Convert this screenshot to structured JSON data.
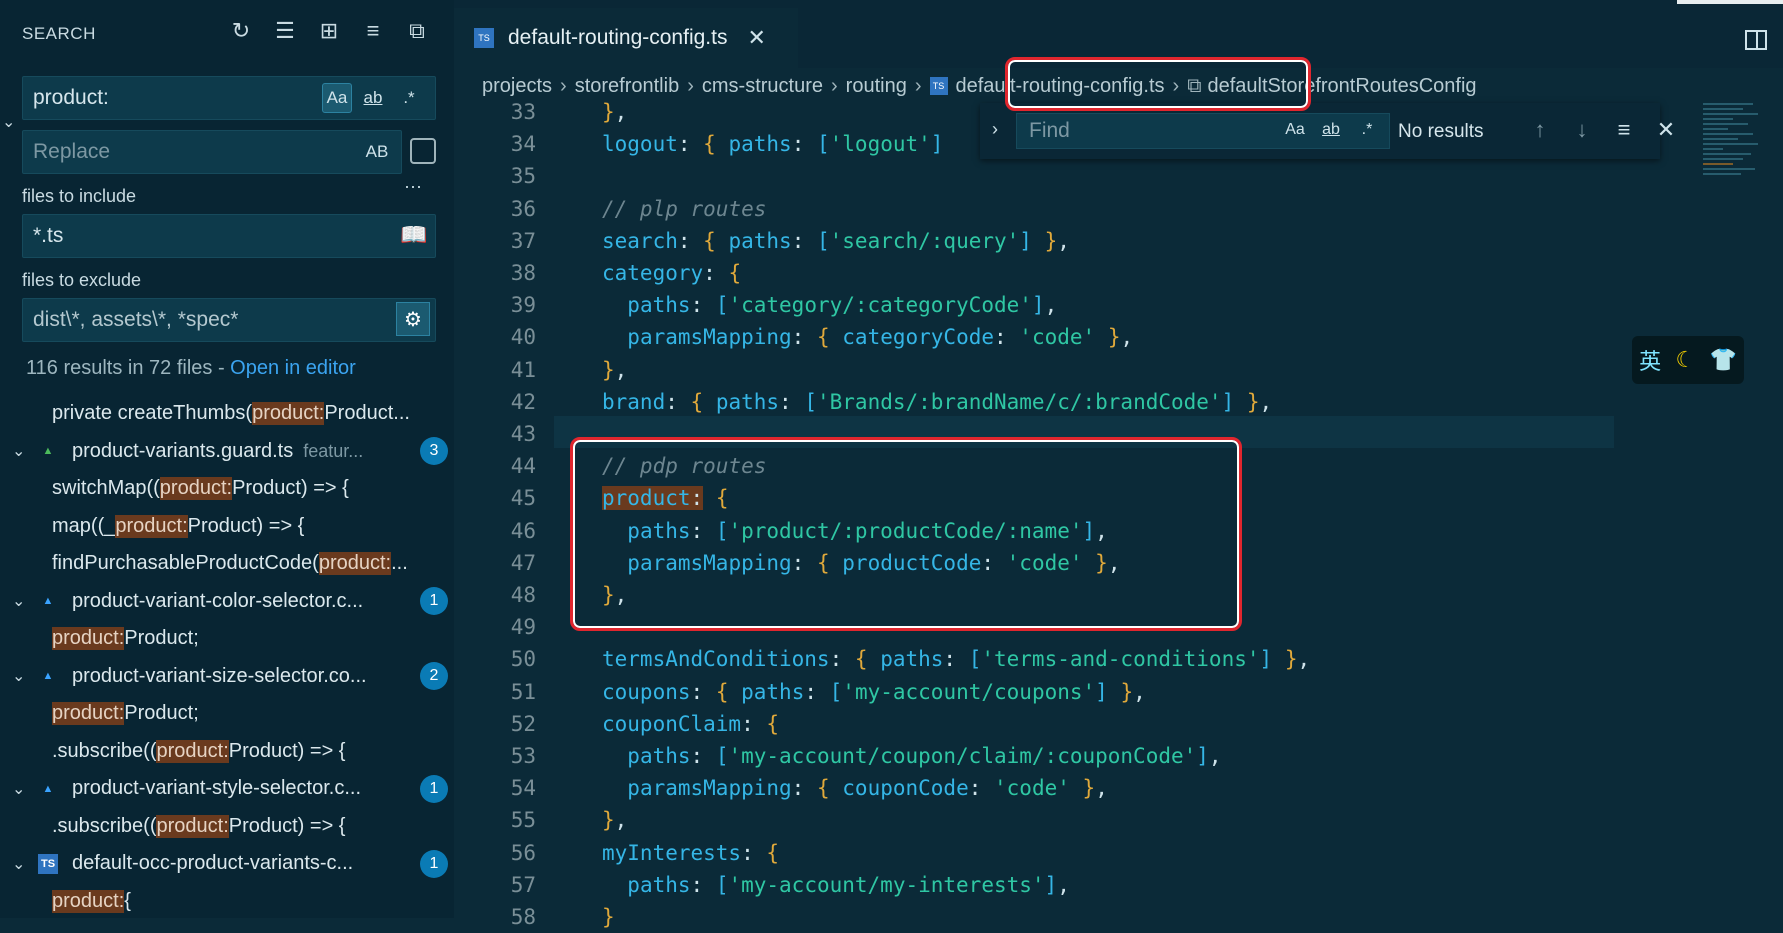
{
  "sidebar": {
    "title": "SEARCH",
    "search_value": "product:",
    "replace_placeholder": "Replace",
    "replace_opt": "AB",
    "include_label": "files to include",
    "include_value": "*.ts",
    "exclude_label": "files to exclude",
    "exclude_value": "dist\\*, assets\\*, *spec*",
    "more": "···",
    "opt_case": "Aa",
    "opt_word": "ab",
    "opt_regex": ".*",
    "summary": "116 results in 72 files - ",
    "open_in_editor": "Open in editor",
    "results": [
      {
        "type": "match",
        "pre": "private createThumbs(",
        "hl": "product:",
        "post": " Product..."
      },
      {
        "type": "file",
        "name": "product-variants.guard.ts",
        "path": "featur...",
        "count": "3",
        "icon": "angular-green"
      },
      {
        "type": "match",
        "pre": "switchMap((",
        "hl": "product:",
        "post": " Product) => {"
      },
      {
        "type": "match",
        "pre": "map((_",
        "hl": "product:",
        "post": " Product) => {"
      },
      {
        "type": "match",
        "pre": "findPurchasableProductCode(",
        "hl": "product:",
        "post": " ..."
      },
      {
        "type": "file",
        "name": "product-variant-color-selector.c...",
        "path": "",
        "count": "1",
        "icon": "angular"
      },
      {
        "type": "match",
        "pre": "",
        "hl": "product:",
        "post": " Product;"
      },
      {
        "type": "file",
        "name": "product-variant-size-selector.co...",
        "path": "",
        "count": "2",
        "icon": "angular"
      },
      {
        "type": "match",
        "pre": "",
        "hl": "product:",
        "post": " Product;"
      },
      {
        "type": "match",
        "pre": ".subscribe((",
        "hl": "product:",
        "post": " Product) => {"
      },
      {
        "type": "file",
        "name": "product-variant-style-selector.c...",
        "path": "",
        "count": "1",
        "icon": "angular"
      },
      {
        "type": "match",
        "pre": ".subscribe((",
        "hl": "product:",
        "post": " Product) => {"
      },
      {
        "type": "file",
        "name": "default-occ-product-variants-c...",
        "path": "",
        "count": "1",
        "icon": "ts"
      },
      {
        "type": "match",
        "pre": "",
        "hl": "product:",
        "post": " {"
      }
    ]
  },
  "editor": {
    "tab": "default-routing-config.ts",
    "ts_label": "TS",
    "breadcrumbs": [
      "projects",
      "storefrontlib",
      "cms-structure",
      "routing",
      "default-routing-config.ts",
      "defaultStorefrontRoutesConfig"
    ],
    "find": {
      "placeholder": "Find",
      "status": "No results",
      "case": "Aa",
      "word": "ab",
      "regex": ".*"
    },
    "lines": [
      {
        "n": "33",
        "html": "<span class='p'>}</span><span class='w'>,</span>"
      },
      {
        "n": "34",
        "html": "<span class='k'>logout</span><span class='w'>: </span><span class='p'>{</span><span class='w'> </span><span class='k'>paths</span><span class='w'>: </span><span class='k'>[</span><span class='s'>'logout'</span><span class='k'>]</span>"
      },
      {
        "n": "35",
        "html": ""
      },
      {
        "n": "36",
        "html": "<span class='c'>// plp routes</span>"
      },
      {
        "n": "37",
        "html": "<span class='k'>search</span><span class='w'>: </span><span class='p'>{</span><span class='w'> </span><span class='k'>paths</span><span class='w'>: </span><span class='k'>[</span><span class='s'>'search/:query'</span><span class='k'>]</span><span class='w'> </span><span class='p'>}</span><span class='w'>,</span>"
      },
      {
        "n": "38",
        "html": "<span class='k'>category</span><span class='w'>: </span><span class='p'>{</span>"
      },
      {
        "n": "39",
        "html": "  <span class='k'>paths</span><span class='w'>: </span><span class='k'>[</span><span class='s'>'category/:categoryCode'</span><span class='k'>]</span><span class='w'>,</span>"
      },
      {
        "n": "40",
        "html": "  <span class='k'>paramsMapping</span><span class='w'>: </span><span class='p'>{</span><span class='w'> </span><span class='k'>categoryCode</span><span class='w'>: </span><span class='s'>'code'</span><span class='w'> </span><span class='p'>}</span><span class='w'>,</span>"
      },
      {
        "n": "41",
        "html": "<span class='p'>}</span><span class='w'>,</span>"
      },
      {
        "n": "42",
        "html": "<span class='k'>brand</span><span class='w'>: </span><span class='p'>{</span><span class='w'> </span><span class='k'>paths</span><span class='w'>: </span><span class='k'>[</span><span class='s'>'Brands/:brandName/c/:brandCode'</span><span class='k'>]</span><span class='w'> </span><span class='p'>}</span><span class='w'>,</span>"
      },
      {
        "n": "43",
        "html": ""
      },
      {
        "n": "44",
        "html": "<span class='c'>// pdp routes</span>"
      },
      {
        "n": "45",
        "html": "<span class='k hl' style='background:#6a3a1e;'>product</span><span class='w hl' style='background:#6a3a1e;'>:</span><span class='w'> </span><span class='p'>{</span>"
      },
      {
        "n": "46",
        "html": "  <span class='k'>paths</span><span class='w'>: </span><span class='k'>[</span><span class='s'>'product/:productCode/:name'</span><span class='k'>]</span><span class='w'>,</span>"
      },
      {
        "n": "47",
        "html": "  <span class='k'>paramsMapping</span><span class='w'>: </span><span class='p'>{</span><span class='w'> </span><span class='k'>productCode</span><span class='w'>: </span><span class='s'>'code'</span><span class='w'> </span><span class='p'>}</span><span class='w'>,</span>"
      },
      {
        "n": "48",
        "html": "<span class='p'>}</span><span class='w'>,</span>"
      },
      {
        "n": "49",
        "html": ""
      },
      {
        "n": "50",
        "html": "<span class='k'>termsAndConditions</span><span class='w'>: </span><span class='p'>{</span><span class='w'> </span><span class='k'>paths</span><span class='w'>: </span><span class='k'>[</span><span class='s'>'terms-and-conditions'</span><span class='k'>]</span><span class='w'> </span><span class='p'>}</span><span class='w'>,</span>"
      },
      {
        "n": "51",
        "html": "<span class='k'>coupons</span><span class='w'>: </span><span class='p'>{</span><span class='w'> </span><span class='k'>paths</span><span class='w'>: </span><span class='k'>[</span><span class='s'>'my-account/coupons'</span><span class='k'>]</span><span class='w'> </span><span class='p'>}</span><span class='w'>,</span>"
      },
      {
        "n": "52",
        "html": "<span class='k'>couponClaim</span><span class='w'>: </span><span class='p'>{</span>"
      },
      {
        "n": "53",
        "html": "  <span class='k'>paths</span><span class='w'>: </span><span class='k'>[</span><span class='s'>'my-account/coupon/claim/:couponCode'</span><span class='k'>]</span><span class='w'>,</span>"
      },
      {
        "n": "54",
        "html": "  <span class='k'>paramsMapping</span><span class='w'>: </span><span class='p'>{</span><span class='w'> </span><span class='k'>couponCode</span><span class='w'>: </span><span class='s'>'code'</span><span class='w'> </span><span class='p'>}</span><span class='w'>,</span>"
      },
      {
        "n": "55",
        "html": "<span class='p'>}</span><span class='w'>,</span>"
      },
      {
        "n": "56",
        "html": "<span class='k'>myInterests</span><span class='w'>: </span><span class='p'>{</span>"
      },
      {
        "n": "57",
        "html": "  <span class='k'>paths</span><span class='w'>: </span><span class='k'>[</span><span class='s'>'my-account/my-interests'</span><span class='k'>]</span><span class='w'>,</span>"
      },
      {
        "n": "58",
        "html": "<span class='p'>}</span>"
      }
    ]
  },
  "ime": {
    "lang": "英",
    "moon": "☾",
    "shirt": "👕"
  },
  "colors": {
    "accent": "#3ba4f0",
    "highlight_box": "#e0262e",
    "background": "#0b2a38",
    "sidebar": "#082533"
  },
  "icons": [
    "refresh-icon",
    "clear-results-icon",
    "new-search-editor-icon",
    "collapse-all-icon",
    "expand-icon",
    "split-editor-icon",
    "close-icon",
    "chevron-down-icon",
    "arrow-up-icon",
    "arrow-down-icon",
    "find-in-selection-icon",
    "book-icon",
    "settings-icon",
    "replace-all-icon"
  ]
}
